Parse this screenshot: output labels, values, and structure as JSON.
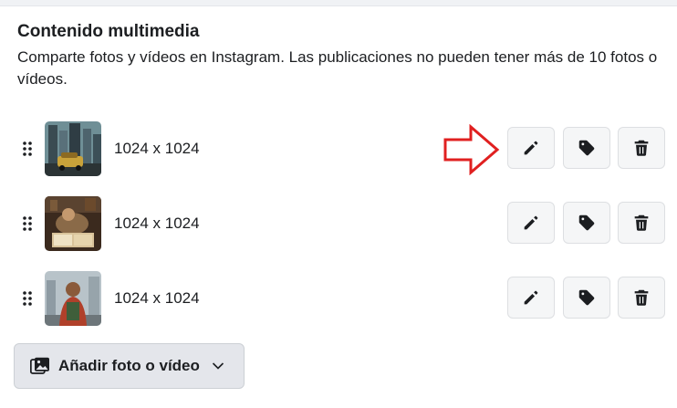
{
  "section": {
    "title": "Contenido multimedia",
    "description": "Comparte fotos y vídeos en Instagram. Las publicaciones no pueden tener más de 10 fotos o vídeos."
  },
  "media_items": [
    {
      "dimensions": "1024 x 1024",
      "thumbnail": "city-street-vehicle"
    },
    {
      "dimensions": "1024 x 1024",
      "thumbnail": "person-reading-books"
    },
    {
      "dimensions": "1024 x 1024",
      "thumbnail": "person-back-city"
    }
  ],
  "actions": {
    "edit_icon": "pencil-icon",
    "tag_icon": "tag-icon",
    "delete_icon": "trash-icon"
  },
  "annotation": {
    "shape": "red-outline-arrow",
    "color": "#e02020",
    "points_to": "edit-button-row-1"
  },
  "add_button": {
    "label": "Añadir foto o vídeo",
    "icon": "photo-gallery-icon",
    "dropdown_icon": "chevron-down-icon"
  },
  "colors": {
    "button_bg": "#f5f6f7",
    "add_button_bg": "#e4e6eb",
    "text": "#1c1e21",
    "arrow": "#e02020"
  }
}
